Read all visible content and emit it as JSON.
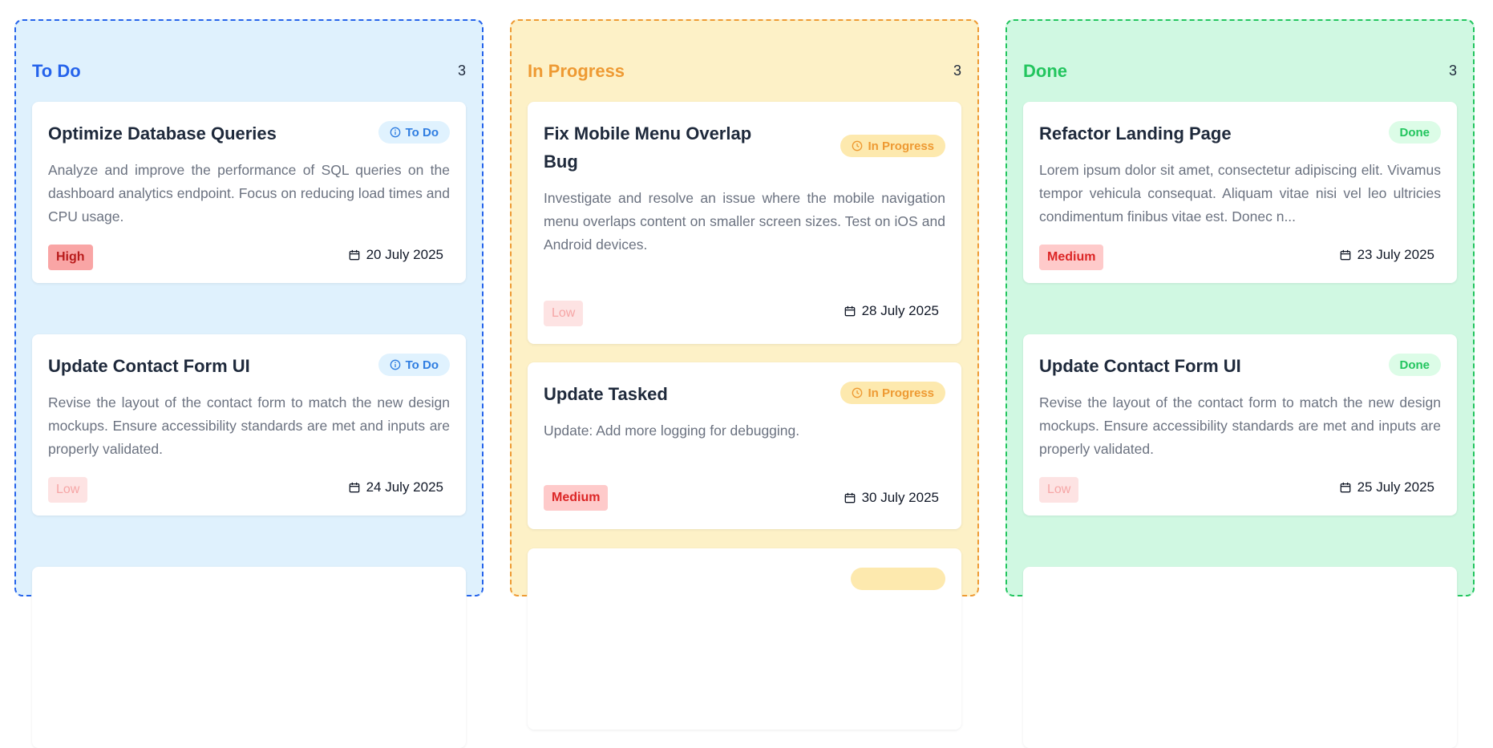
{
  "columns": [
    {
      "title": "To Do",
      "count": "3",
      "cards": [
        {
          "title": "Optimize Database Queries",
          "status": "To Do",
          "description": "Analyze and improve the performance of SQL queries on the dashboard analytics endpoint. Focus on reducing load times and CPU usage.",
          "priority": "High",
          "date": "20 July 2025"
        },
        {
          "title": "Update Contact Form UI",
          "status": "To Do",
          "description": "Revise the layout of the contact form to match the new design mockups. Ensure accessibility standards are met and inputs are properly validated.",
          "priority": "Low",
          "date": "24 July 2025"
        }
      ]
    },
    {
      "title": "In Progress",
      "count": "3",
      "cards": [
        {
          "title": "Fix Mobile Menu Overlap Bug",
          "status": "In Progress",
          "description": "Investigate and resolve an issue where the mobile navigation menu overlaps content on smaller screen sizes. Test on iOS and Android devices.",
          "priority": "Low",
          "date": "28 July 2025"
        },
        {
          "title": "Update Tasked",
          "status": "In Progress",
          "description": "Update: Add more logging for debugging.",
          "priority": "Medium",
          "date": "30 July 2025"
        }
      ]
    },
    {
      "title": "Done",
      "count": "3",
      "cards": [
        {
          "title": "Refactor Landing Page",
          "status": "Done",
          "description": "Lorem ipsum dolor sit amet, consectetur adipiscing elit. Vivamus tempor vehicula consequat. Aliquam vitae nisi vel leo ultricies condimentum finibus vitae est. Donec n...",
          "priority": "Medium",
          "date": "23 July 2025"
        },
        {
          "title": "Update Contact Form UI",
          "status": "Done",
          "description": "Revise the layout of the contact form to match the new design mockups. Ensure accessibility standards are met and inputs are properly validated.",
          "priority": "Low",
          "date": "25 July 2025"
        }
      ]
    }
  ],
  "colors": {
    "todo_accent": "#2563eb",
    "in_progress_accent": "#ee9a33",
    "done_accent": "#22c55e",
    "todo_bg": "#dff1fd",
    "in_progress_bg": "#fdf1c7",
    "done_bg": "#d0f8e2"
  },
  "icons": {
    "status_todo": "info-circle-icon",
    "status_in_progress": "clock-icon",
    "date": "calendar-icon"
  }
}
